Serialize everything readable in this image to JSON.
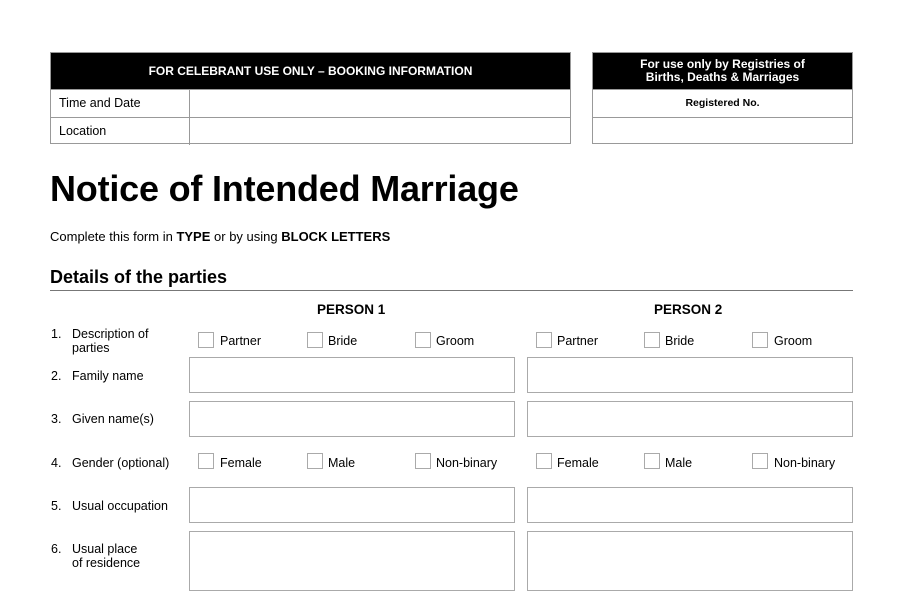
{
  "celebrant_box": {
    "header": "FOR CELEBRANT USE ONLY – BOOKING INFORMATION",
    "rows": [
      {
        "label": "Time and Date",
        "value": ""
      },
      {
        "label": "Location",
        "value": ""
      }
    ]
  },
  "registry_box": {
    "header_line1": "For use only by Registries of",
    "header_line2": "Births, Deaths & Marriages",
    "registered_no_label": "Registered No.",
    "registered_no_value": ""
  },
  "title": "Notice of Intended Marriage",
  "instructions": {
    "part1": "Complete this form in ",
    "type": "TYPE",
    "part2": " or by using ",
    "block": "BLOCK LETTERS"
  },
  "section_heading": "Details of the parties",
  "person_headers": [
    "PERSON 1",
    "PERSON 2"
  ],
  "questions": [
    {
      "num": "1.",
      "label_line1": "Description of",
      "label_line2": "parties",
      "type": "checkbox",
      "options": [
        "Partner",
        "Bride",
        "Groom"
      ]
    },
    {
      "num": "2.",
      "label_line1": "Family name",
      "type": "text",
      "person1_value": "",
      "person2_value": ""
    },
    {
      "num": "3.",
      "label_line1": "Given name(s)",
      "type": "text",
      "person1_value": "",
      "person2_value": ""
    },
    {
      "num": "4.",
      "label_line1": "Gender (optional)",
      "type": "checkbox",
      "options": [
        "Female",
        "Male",
        "Non-binary"
      ]
    },
    {
      "num": "5.",
      "label_line1": "Usual occupation",
      "type": "text",
      "person1_value": "",
      "person2_value": ""
    },
    {
      "num": "6.",
      "label_line1": "Usual place",
      "label_line2": "of residence",
      "type": "text",
      "person1_value": "",
      "person2_value": ""
    }
  ]
}
